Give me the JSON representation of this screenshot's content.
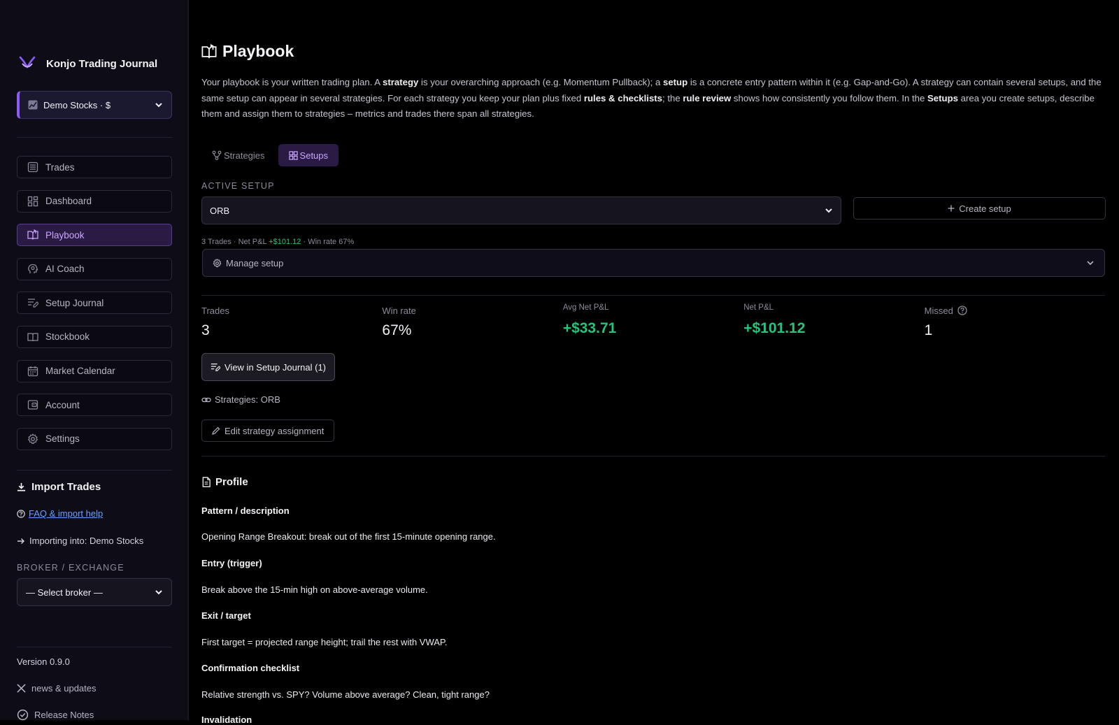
{
  "app": {
    "name": "Konjo Trading Journal",
    "account": "Demo Stocks · $"
  },
  "nav": [
    {
      "id": "trades",
      "label": "Trades",
      "icon": "list-icon"
    },
    {
      "id": "dashboard",
      "label": "Dashboard",
      "icon": "grid-icon"
    },
    {
      "id": "playbook",
      "label": "Playbook",
      "icon": "book-icon",
      "active": true
    },
    {
      "id": "ai-coach",
      "label": "AI Coach",
      "icon": "head-icon"
    },
    {
      "id": "setup-journal",
      "label": "Setup Journal",
      "icon": "notes-icon"
    },
    {
      "id": "stockbook",
      "label": "Stockbook",
      "icon": "open-book-icon"
    },
    {
      "id": "market-calendar",
      "label": "Market Calendar",
      "icon": "calendar-icon"
    },
    {
      "id": "account",
      "label": "Account",
      "icon": "wallet-icon"
    },
    {
      "id": "settings",
      "label": "Settings",
      "icon": "gear-icon"
    }
  ],
  "import": {
    "title": "Import Trades",
    "faq": "FAQ & import help",
    "importing": "Importing into: Demo Stocks",
    "broker_label": "BROKER / EXCHANGE",
    "broker_value": "— Select broker —"
  },
  "footer": {
    "version": "Version 0.9.0",
    "news": "news & updates",
    "release": "Release Notes"
  },
  "page": {
    "title": "Playbook",
    "intro": {
      "p1": "Your playbook is your written trading plan. A ",
      "b1": "strategy",
      "p2": " is your overarching approach (e.g. Momentum Pullback); a ",
      "b2": "setup",
      "p3": " is a concrete entry pattern within it (e.g. Gap-and-Go). A strategy can contain several setups, and the same setup can appear in several strategies. For each strategy you keep your plan plus fixed ",
      "b3": "rules & checklists",
      "p4": "; the ",
      "b4": "rule review",
      "p5": " shows how consistently you follow them. In the ",
      "b5": "Setups",
      "p6": " area you create setups, describe them and assign them to strategies – metrics and trades there span all strategies."
    },
    "tabs": {
      "strategies": "Strategies",
      "setups": "Setups"
    },
    "active_setup_label": "ACTIVE SETUP",
    "active_setup_value": "ORB",
    "create_setup": "Create setup",
    "summary": {
      "trades": "3 Trades",
      "sep": "·",
      "net_label": "Net P&L",
      "net_value": "+$101.12",
      "win": "Win rate 67%"
    },
    "manage_setup": "Manage setup",
    "stats": {
      "trades_label": "Trades",
      "trades_value": "3",
      "winrate_label": "Win rate",
      "winrate_value": "67%",
      "avg_label": "Avg Net P&L",
      "avg_value": "+$33.71",
      "net_label": "Net P&L",
      "net_value": "+$101.12",
      "missed_label": "Missed",
      "missed_value": "1"
    },
    "view_journal": "View in Setup Journal (1)",
    "strategies_line": "Strategies: ORB",
    "edit_assignment": "Edit strategy assignment",
    "profile": {
      "title": "Profile",
      "pattern_h": "Pattern / description",
      "pattern": "Opening Range Breakout: break out of the first 15-minute opening range.",
      "entry_h": "Entry (trigger)",
      "entry": "Break above the 15-min high on above-average volume.",
      "exit_h": "Exit / target",
      "exit": "First target = projected range height; trail the rest with VWAP.",
      "confirm_h": "Confirmation checklist",
      "confirm": "Relative strength vs. SPY? Volume above average? Clean, tight range?",
      "invalid_h": "Invalidation"
    }
  },
  "colors": {
    "accent": "#8b5cf6",
    "positive": "#22c57a",
    "link": "#6aa1ff"
  }
}
